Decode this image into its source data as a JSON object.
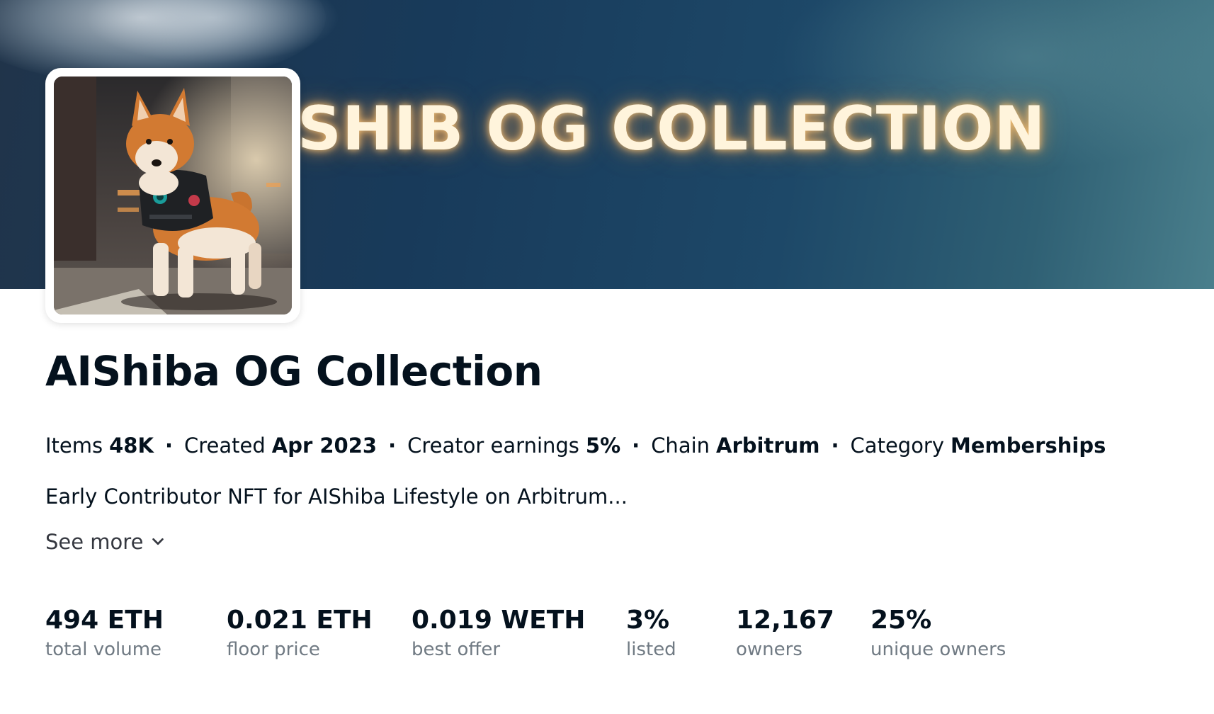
{
  "banner": {
    "text": "SHIB OG COLLECTION"
  },
  "avatar": {
    "alt": "Shiba dog in armor vest"
  },
  "collection": {
    "title": "AIShiba OG Collection"
  },
  "meta": {
    "items_label": "Items",
    "items_value": "48K",
    "created_label": "Created",
    "created_value": "Apr 2023",
    "earnings_label": "Creator earnings",
    "earnings_value": "5%",
    "chain_label": "Chain",
    "chain_value": "Arbitrum",
    "category_label": "Category",
    "category_value": "Memberships",
    "separator": "·"
  },
  "description": "Early Contributor NFT for AIShiba Lifestyle on Arbitrum...",
  "see_more_label": "See more",
  "stats": [
    {
      "value": "494 ETH",
      "label": "total volume"
    },
    {
      "value": "0.021 ETH",
      "label": "floor price"
    },
    {
      "value": "0.019 WETH",
      "label": "best offer"
    },
    {
      "value": "3%",
      "label": "listed"
    },
    {
      "value": "12,167",
      "label": "owners"
    },
    {
      "value": "25%",
      "label": "unique owners"
    }
  ],
  "colors": {
    "text": "#04111d",
    "muted": "#707a83",
    "banner_glow": "#fff4dc"
  },
  "icons": {
    "see_more": "chevron-down-icon"
  }
}
